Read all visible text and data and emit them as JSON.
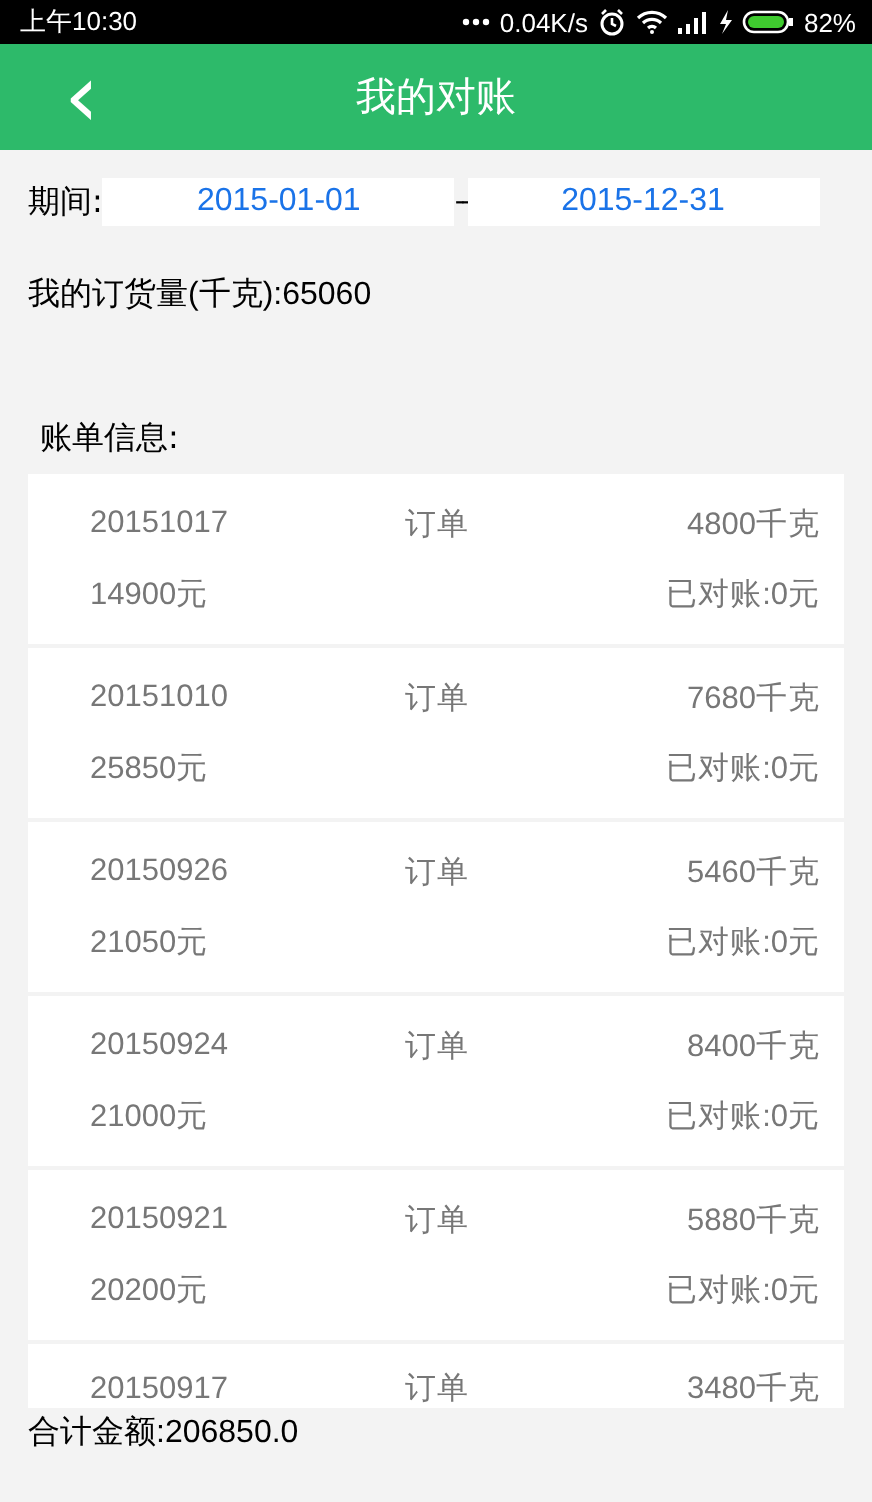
{
  "status_bar": {
    "time": "上午10:30",
    "speed": "0.04K/s",
    "battery": "82%"
  },
  "header": {
    "back": "‹",
    "title": "我的对账"
  },
  "period": {
    "label": "期间:",
    "from": "2015-01-01",
    "separator": "--",
    "to": "2015-12-31"
  },
  "order_total": "我的订货量(千克):65060",
  "list_title": "账单信息:",
  "bills": [
    {
      "date": "20151017",
      "type": "订单",
      "weight": "4800千克",
      "amount": "14900元",
      "reconciled": "已对账:0元"
    },
    {
      "date": "20151010",
      "type": "订单",
      "weight": "7680千克",
      "amount": "25850元",
      "reconciled": "已对账:0元"
    },
    {
      "date": "20150926",
      "type": "订单",
      "weight": "5460千克",
      "amount": "21050元",
      "reconciled": "已对账:0元"
    },
    {
      "date": "20150924",
      "type": "订单",
      "weight": "8400千克",
      "amount": "21000元",
      "reconciled": "已对账:0元"
    },
    {
      "date": "20150921",
      "type": "订单",
      "weight": "5880千克",
      "amount": "20200元",
      "reconciled": "已对账:0元"
    },
    {
      "date": "20150917",
      "type": "订单",
      "weight": "3480千克"
    }
  ],
  "sum": "合计金额:206850.0"
}
